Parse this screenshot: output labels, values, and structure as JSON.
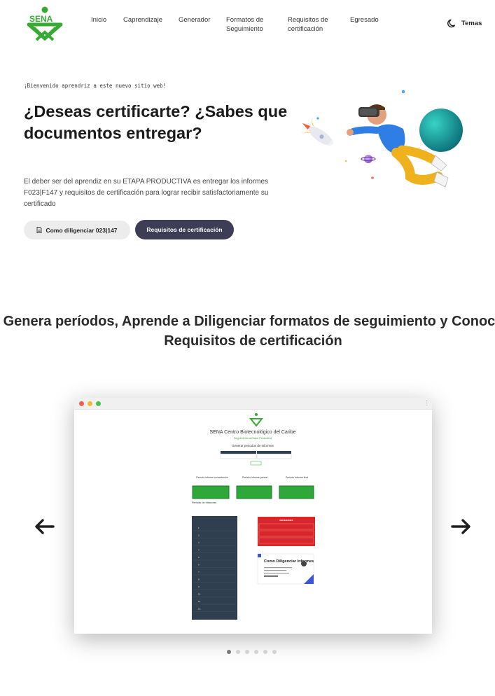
{
  "brand": {
    "logo_text": "SENA",
    "color": "#39a935"
  },
  "nav": {
    "items": [
      {
        "label": "Inicio"
      },
      {
        "label": "Caprendizaje"
      },
      {
        "label": "Generador"
      },
      {
        "label": "Formatos de Seguimiento"
      },
      {
        "label": "Requisitos de certificación"
      },
      {
        "label": "Egresado"
      }
    ],
    "theme": {
      "label": "Temas",
      "icon": "moon-icon"
    }
  },
  "hero": {
    "welcome": "¡Bienvenido aprendriz a este nuevo sitio web!",
    "title": "¿Deseas certificarte? ¿Sabes que documentos entregar?",
    "description": "El deber ser del aprendiz en su ETAPA PRODUCTIVA es entregar los informes F023|F147 y requisitos de certificación para lograr recibir satisfactoriamente su certificado",
    "button_primary": {
      "label": "Como diligenciar 023|147",
      "icon": "document-icon"
    },
    "button_secondary": {
      "label": "Requisitos de certificación"
    }
  },
  "section": {
    "title": "Genera períodos, Aprende a Diligenciar formatos de seguimiento y Conoce Requisitos de certificación"
  },
  "carousel": {
    "slide": {
      "site_title": "SENA Centro Biotecnológico del Caribe",
      "site_subtitle": "Seguimiento a Etapa Productiva",
      "generator_title": "Generar periodos de informes",
      "periods": [
        {
          "label": "Periodo informe concertación"
        },
        {
          "label": "Periodo informe parcial"
        },
        {
          "label": "Periodo informe final"
        }
      ],
      "bitacoras_title": "Período de bitácoras",
      "table_rows": [
        "1",
        "2",
        "3",
        "4",
        "5",
        "6",
        "7",
        "8",
        "9",
        "10",
        "11",
        "12"
      ],
      "news_title": "NOVEDADES",
      "promo_title": "Como Diligenciar Informes"
    },
    "slide_count": 6,
    "active_index": 0,
    "prev_icon": "arrow-left-icon",
    "next_icon": "arrow-right-icon"
  },
  "colors": {
    "accent_dark": "#3d3d55",
    "sena_green": "#39a935",
    "table_dark": "#2f3f4f",
    "alert_red": "#d8262a"
  }
}
